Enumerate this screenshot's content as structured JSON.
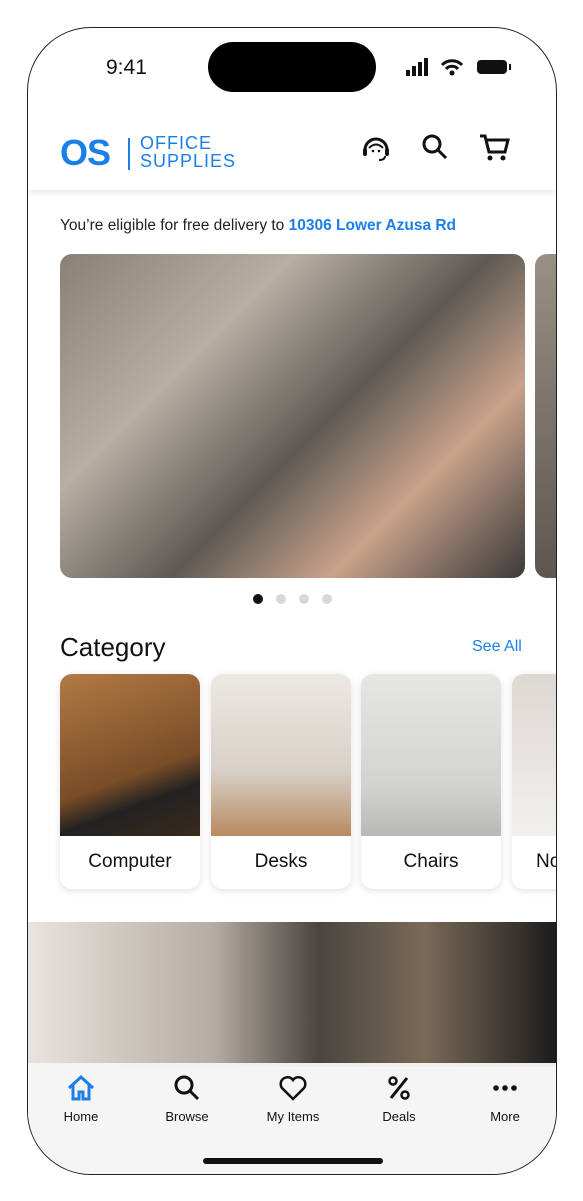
{
  "status": {
    "time": "9:41"
  },
  "header": {
    "logo_mark": "OS",
    "logo_line1": "OFFICE",
    "logo_line2": "SUPPLIES",
    "icons": [
      "support-headset-icon",
      "search-icon",
      "cart-icon"
    ]
  },
  "delivery": {
    "text": "You’re eligible for free delivery to ",
    "address": "10306 Lower Azusa Rd"
  },
  "carousel": {
    "slides": 4,
    "active": 1
  },
  "category": {
    "title": "Category",
    "see_all": "See All",
    "items": [
      {
        "label": "Computer"
      },
      {
        "label": "Desks"
      },
      {
        "label": "Chairs"
      },
      {
        "label": "No"
      }
    ]
  },
  "tabs": [
    {
      "label": "Home",
      "icon": "home-icon",
      "active": true
    },
    {
      "label": "Browse",
      "icon": "search-icon"
    },
    {
      "label": "My Items",
      "icon": "heart-icon"
    },
    {
      "label": "Deals",
      "icon": "percent-icon"
    },
    {
      "label": "More",
      "icon": "more-icon"
    }
  ],
  "colors": {
    "accent": "#1a7fe8"
  }
}
